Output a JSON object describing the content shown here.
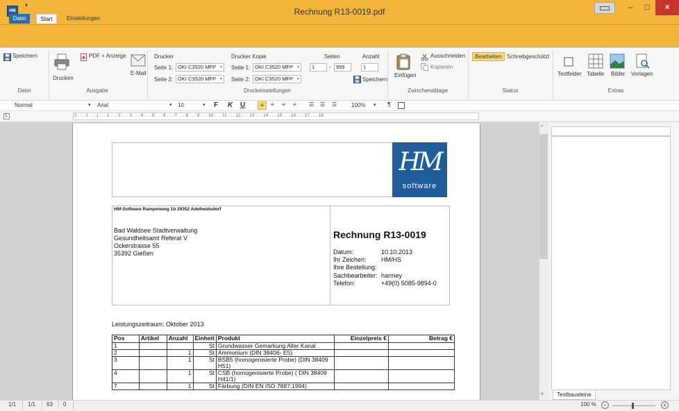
{
  "window": {
    "title": "Rechnung R13-0019.pdf",
    "icon_text": "HM",
    "min": "–",
    "max": "□",
    "close": "×"
  },
  "tabs": {
    "datei": "Datei",
    "start": "Start",
    "einstellungen": "Einstellungen",
    "qat": "▾"
  },
  "ribbon": {
    "datei": {
      "save": "Speichern",
      "label": "Datei"
    },
    "ausgabe": {
      "print": "Drucken",
      "pdf": "PDF + Anzeige",
      "email": "E-Mail",
      "label": "Ausgabe"
    },
    "druck": {
      "drucker": "Drucker",
      "drucker_kopie": "Drucker Kopie",
      "seite1": "Seite 1:",
      "seite2": "Seite 2:",
      "printer1": "OKI C3520 MFP",
      "printer2": "OKI C3520 MFP",
      "printer3": "OKI C3520 MFP",
      "printer4": "OKI C3520 MFP",
      "seiten": "Seiten",
      "from": "1",
      "dash": "-",
      "to": "999",
      "anzahl": "Anzahl",
      "count": "1",
      "save": "Speichern",
      "label": "Druckeinstellungen"
    },
    "clip": {
      "paste": "Einfügen",
      "cut": "Ausschneiden",
      "copy": "Kopieren",
      "label": "Zwischenablage"
    },
    "status": {
      "edit": "Bearbeiten",
      "readonly": "Schreibgeschützt",
      "label": "Status"
    },
    "extras": {
      "textfields": "Textfelder",
      "table": "Tabelle",
      "images": "Bilder",
      "templates": "Vorlagen",
      "label": "Extras"
    }
  },
  "format": {
    "style": "Normal",
    "font": "Arial",
    "size": "10",
    "bold": "F",
    "italic": "K",
    "underline": "U",
    "zoom": "100%",
    "para": "¶"
  },
  "ruler": {
    "marks": "2 . . . 1 . . . | . . . 1 . . . 2 . . . 3 . . . 4 . . . 5 . . . 6 . . . 7 . . . 8 . . . 9 . . . 10 . . . 11 . . . 12 . . . 13 . . . 14 . . . 15 . . . 16 . . . 17 . . . 18"
  },
  "doc": {
    "logo_main": "HM",
    "logo_sub": "software",
    "sender_brand": "HM-Software",
    "sender_rest": " Rampenweg 1b  29352 Adelheidsdorf",
    "recipient": [
      "Bad Waldsee Stadtverwaltung",
      "Gesundheitsamt Referat V",
      "Ockerstrasse 55",
      "35392 Gießen"
    ],
    "invoice_title": "Rechnung R13-0019",
    "info": [
      {
        "k": "Datum:",
        "v": "10.10.2013"
      },
      {
        "k": "Ihr Zeichen:",
        "v": "HM/HS"
      },
      {
        "k": "Ihre Bestellung:",
        "v": ""
      },
      {
        "k": "Sachbearbeiter:",
        "v": "harmey"
      },
      {
        "k": "Telefon:",
        "v": "+49(0) 5085-9894-0"
      }
    ],
    "period": "Leistungszeitraum:  Oktober 2013",
    "table": {
      "headers": [
        "Pos",
        "Artikel",
        "Anzahl",
        "Einheit",
        "Produkt",
        "Einzelpreis €",
        "Betrag €"
      ],
      "rows": [
        [
          "1",
          "",
          "",
          "St",
          "Grundwasser Gemarkung Alter Kanal",
          "",
          ""
        ],
        [
          "2",
          "",
          "1",
          "St",
          "Ammonium (DIN 38406- E5)",
          "",
          ""
        ],
        [
          "3",
          "",
          "1",
          "St",
          "BSB5 (homogenisierte Probe) (DIN 38409 H51)",
          "",
          ""
        ],
        [
          "4",
          "",
          "1",
          "St",
          "CSB (homogenisierte Probe) ( DIN 38409 H41/1)",
          "",
          ""
        ],
        [
          "7",
          "",
          "1",
          "St",
          "Färbung (DIN EN ISO 7887:1994)",
          "",
          ""
        ]
      ]
    }
  },
  "panel": {
    "tab": "Textbausteine"
  },
  "status": {
    "a": "1/1",
    "b": "1/1",
    "c": "63",
    "d": "0",
    "zoom": "100 %",
    "zoom_out": "−",
    "zoom_in": "+"
  },
  "colors": {
    "titlebar": "#f2b53a",
    "accent": "#2a6db5",
    "logo": "#1f5d9b"
  }
}
